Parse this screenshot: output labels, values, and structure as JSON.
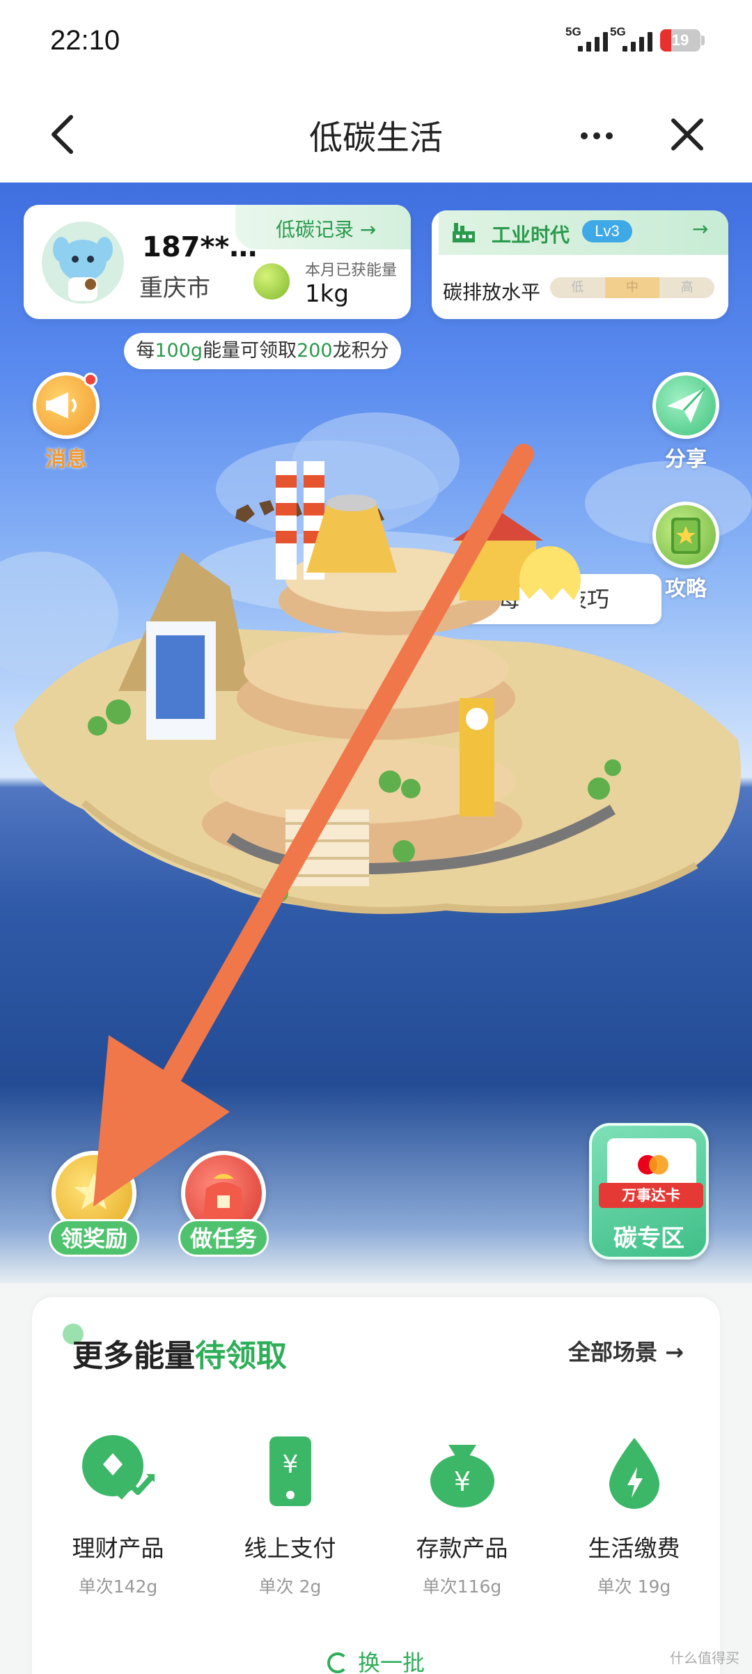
{
  "status_bar": {
    "time": "22:10",
    "network_1": "5G",
    "network_2": "5G",
    "battery": "19"
  },
  "nav": {
    "title": "低碳生活",
    "back_icon": "chevron-left-icon",
    "more_icon": "more-dots-icon",
    "close_icon": "close-icon"
  },
  "user_card": {
    "name": "187**…",
    "city": "重庆市",
    "record_link": "低碳记录 →",
    "month_label": "本月已获能量",
    "month_value": "1kg"
  },
  "era_card": {
    "era_name": "工业时代",
    "level": "Lv3",
    "arrow": "→",
    "emission_label": "碳排放水平",
    "levels": [
      "低",
      "中",
      "高"
    ],
    "current_level": "中"
  },
  "energy_tip": {
    "p1": "每",
    "v1": "100g",
    "p2": "能量可领取",
    "v2": "200",
    "p3": "龙积分"
  },
  "side_buttons": {
    "message": "消息",
    "share": "分享",
    "guide": "攻略"
  },
  "tips_bubble": "每日小技巧",
  "bottom_buttons": {
    "reward": "领奖励",
    "task": "做任务",
    "carbon_ribbon": "万事达卡",
    "carbon_zone": "碳专区"
  },
  "panel": {
    "title_main": "更多能量",
    "title_green": "待领取",
    "all_scenes": "全部场景 →",
    "items": [
      {
        "name": "理财产品",
        "sub": "单次142g",
        "icon": "finance-icon"
      },
      {
        "name": "线上支付",
        "sub": "单次 2g",
        "icon": "phone-pay-icon"
      },
      {
        "name": "存款产品",
        "sub": "单次116g",
        "icon": "money-bag-icon"
      },
      {
        "name": "生活缴费",
        "sub": "单次 19g",
        "icon": "energy-drop-icon"
      }
    ],
    "refresh": "换一批"
  },
  "watermark": "什么值得买",
  "colors": {
    "accent_green": "#2fae59",
    "annotation_arrow": "#f0774a"
  }
}
